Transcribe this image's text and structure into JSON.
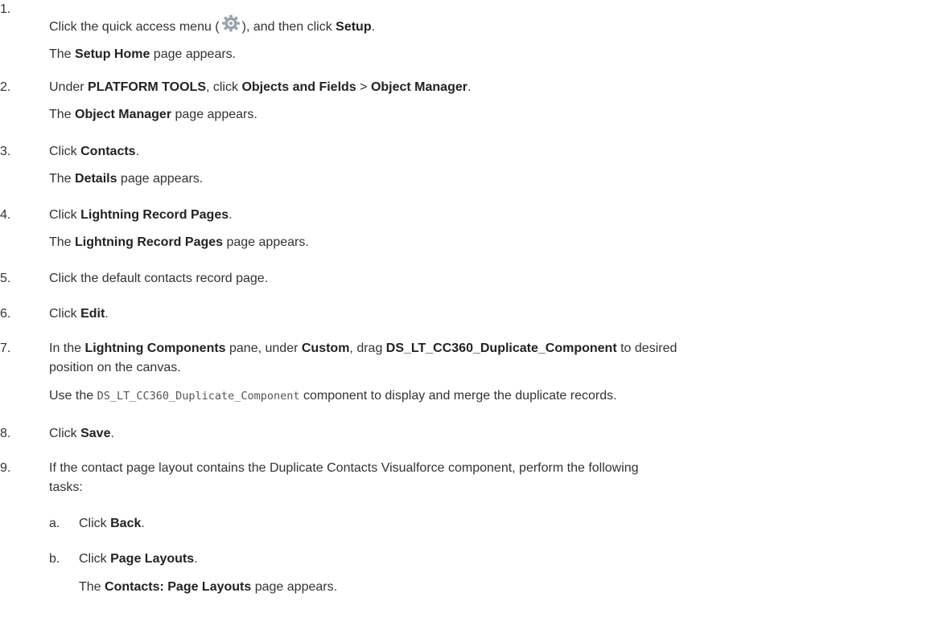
{
  "steps": [
    {
      "n": "1.",
      "parts": [
        "Click the quick access menu (",
        "), and then click ",
        "Setup",
        "."
      ],
      "icon": "gear-icon",
      "result": [
        "The ",
        "Setup Home",
        " page appears."
      ]
    },
    {
      "n": "2.",
      "parts": [
        "Under ",
        "PLATFORM TOOLS",
        ", click ",
        "Objects and Fields",
        " > ",
        "Object Manager",
        "."
      ],
      "result": [
        "The ",
        "Object Manager",
        " page appears."
      ]
    },
    {
      "n": "3.",
      "parts": [
        "Click ",
        "Contacts",
        "."
      ],
      "result": [
        "The ",
        "Details",
        " page appears."
      ]
    },
    {
      "n": "4.",
      "parts": [
        "Click ",
        "Lightning Record Pages",
        "."
      ],
      "result": [
        "The ",
        "Lightning Record Pages",
        " page appears."
      ]
    },
    {
      "n": "5.",
      "text": "Click the default contacts record page."
    },
    {
      "n": "6.",
      "parts": [
        "Click ",
        "Edit",
        "."
      ]
    },
    {
      "n": "7.",
      "parts": [
        "In the ",
        "Lightning Components",
        " pane, under ",
        "Custom",
        ", drag ",
        "DS_LT_CC360_Duplicate_Component",
        " to desired"
      ],
      "line2": "position on the canvas.",
      "note": [
        "Use the ",
        "DS_LT_CC360_Duplicate_Component",
        " component to display and merge the duplicate records."
      ]
    },
    {
      "n": "8.",
      "parts": [
        "Click ",
        "Save",
        "."
      ]
    },
    {
      "n": "9.",
      "text": "If the contact page layout contains the Duplicate Contacts Visualforce component, perform the following",
      "line2": "tasks:"
    }
  ],
  "substeps": [
    {
      "n": "a.",
      "parts": [
        "Click ",
        "Back",
        "."
      ]
    },
    {
      "n": "b.",
      "parts": [
        "Click ",
        "Page Layouts",
        "."
      ],
      "result": [
        "The ",
        "Contacts: Page Layouts",
        " page appears."
      ]
    }
  ],
  "colors": {
    "text": "#333333",
    "gear": "#9aa4ad"
  }
}
